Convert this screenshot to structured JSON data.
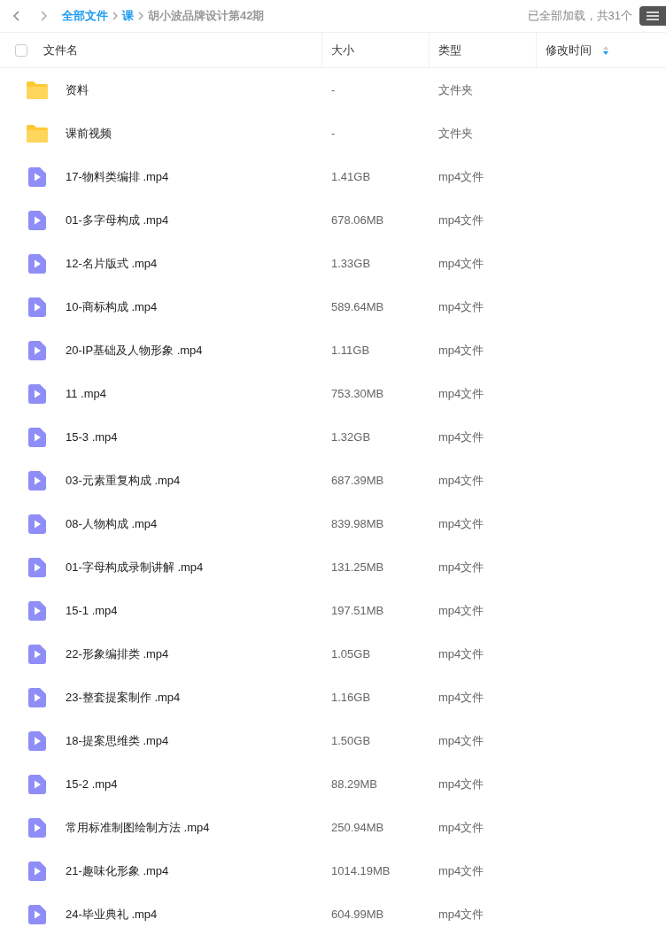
{
  "breadcrumb": [
    {
      "label": "全部文件",
      "kind": "link"
    },
    {
      "label": "课",
      "kind": "link"
    },
    {
      "label": "胡小波品牌设计第42期",
      "kind": "current"
    }
  ],
  "load_status": "已全部加载，共31个",
  "table": {
    "columns": [
      "文件名",
      "大小",
      "类型",
      "修改时间"
    ],
    "all_checked": false,
    "rows": [
      {
        "kind": "folder",
        "name": "资料",
        "size": "-",
        "type": "文件夹"
      },
      {
        "kind": "folder",
        "name": "课前视频",
        "size": "-",
        "type": "文件夹"
      },
      {
        "kind": "video",
        "name": "17-物料类编排 .mp4",
        "size": "1.41GB",
        "type": "mp4文件"
      },
      {
        "kind": "video",
        "name": "01-多字母构成 .mp4",
        "size": "678.06MB",
        "type": "mp4文件"
      },
      {
        "kind": "video",
        "name": "12-名片版式 .mp4",
        "size": "1.33GB",
        "type": "mp4文件"
      },
      {
        "kind": "video",
        "name": "10-商标构成 .mp4",
        "size": "589.64MB",
        "type": "mp4文件"
      },
      {
        "kind": "video",
        "name": "20-IP基础及人物形象 .mp4",
        "size": "1.11GB",
        "type": "mp4文件"
      },
      {
        "kind": "video",
        "name": "11 .mp4",
        "size": "753.30MB",
        "type": "mp4文件"
      },
      {
        "kind": "video",
        "name": "15-3 .mp4",
        "size": "1.32GB",
        "type": "mp4文件"
      },
      {
        "kind": "video",
        "name": "03-元素重复构成 .mp4",
        "size": "687.39MB",
        "type": "mp4文件"
      },
      {
        "kind": "video",
        "name": "08-人物构成 .mp4",
        "size": "839.98MB",
        "type": "mp4文件"
      },
      {
        "kind": "video",
        "name": "01-字母构成录制讲解 .mp4",
        "size": "131.25MB",
        "type": "mp4文件"
      },
      {
        "kind": "video",
        "name": "15-1 .mp4",
        "size": "197.51MB",
        "type": "mp4文件"
      },
      {
        "kind": "video",
        "name": "22-形象编排类 .mp4",
        "size": "1.05GB",
        "type": "mp4文件"
      },
      {
        "kind": "video",
        "name": "23-整套提案制作 .mp4",
        "size": "1.16GB",
        "type": "mp4文件"
      },
      {
        "kind": "video",
        "name": "18-提案思维类 .mp4",
        "size": "1.50GB",
        "type": "mp4文件"
      },
      {
        "kind": "video",
        "name": "15-2 .mp4",
        "size": "88.29MB",
        "type": "mp4文件"
      },
      {
        "kind": "video",
        "name": "常用标准制图绘制方法 .mp4",
        "size": "250.94MB",
        "type": "mp4文件"
      },
      {
        "kind": "video",
        "name": "21-趣味化形象 .mp4",
        "size": "1014.19MB",
        "type": "mp4文件"
      },
      {
        "kind": "video",
        "name": "24-毕业典礼 .mp4",
        "size": "604.99MB",
        "type": "mp4文件"
      }
    ]
  }
}
